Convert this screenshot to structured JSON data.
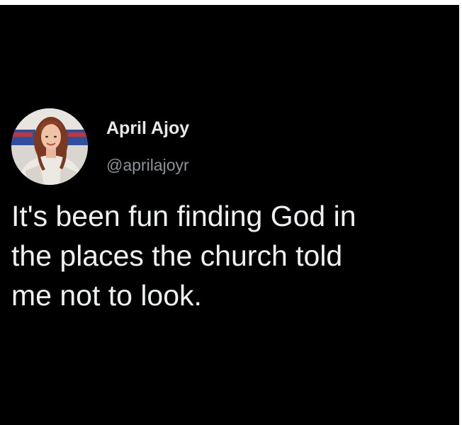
{
  "tweet": {
    "author": {
      "display_name": "April Ajoy",
      "handle": "@aprilajoyr",
      "avatar_icon": "profile-photo"
    },
    "text_lines": [
      "It's been fun finding God in",
      "the places the church told",
      "me not to look."
    ]
  },
  "colors": {
    "background": "#000000",
    "primary_text": "#e7e9ea",
    "secondary_text": "#8b9298"
  }
}
